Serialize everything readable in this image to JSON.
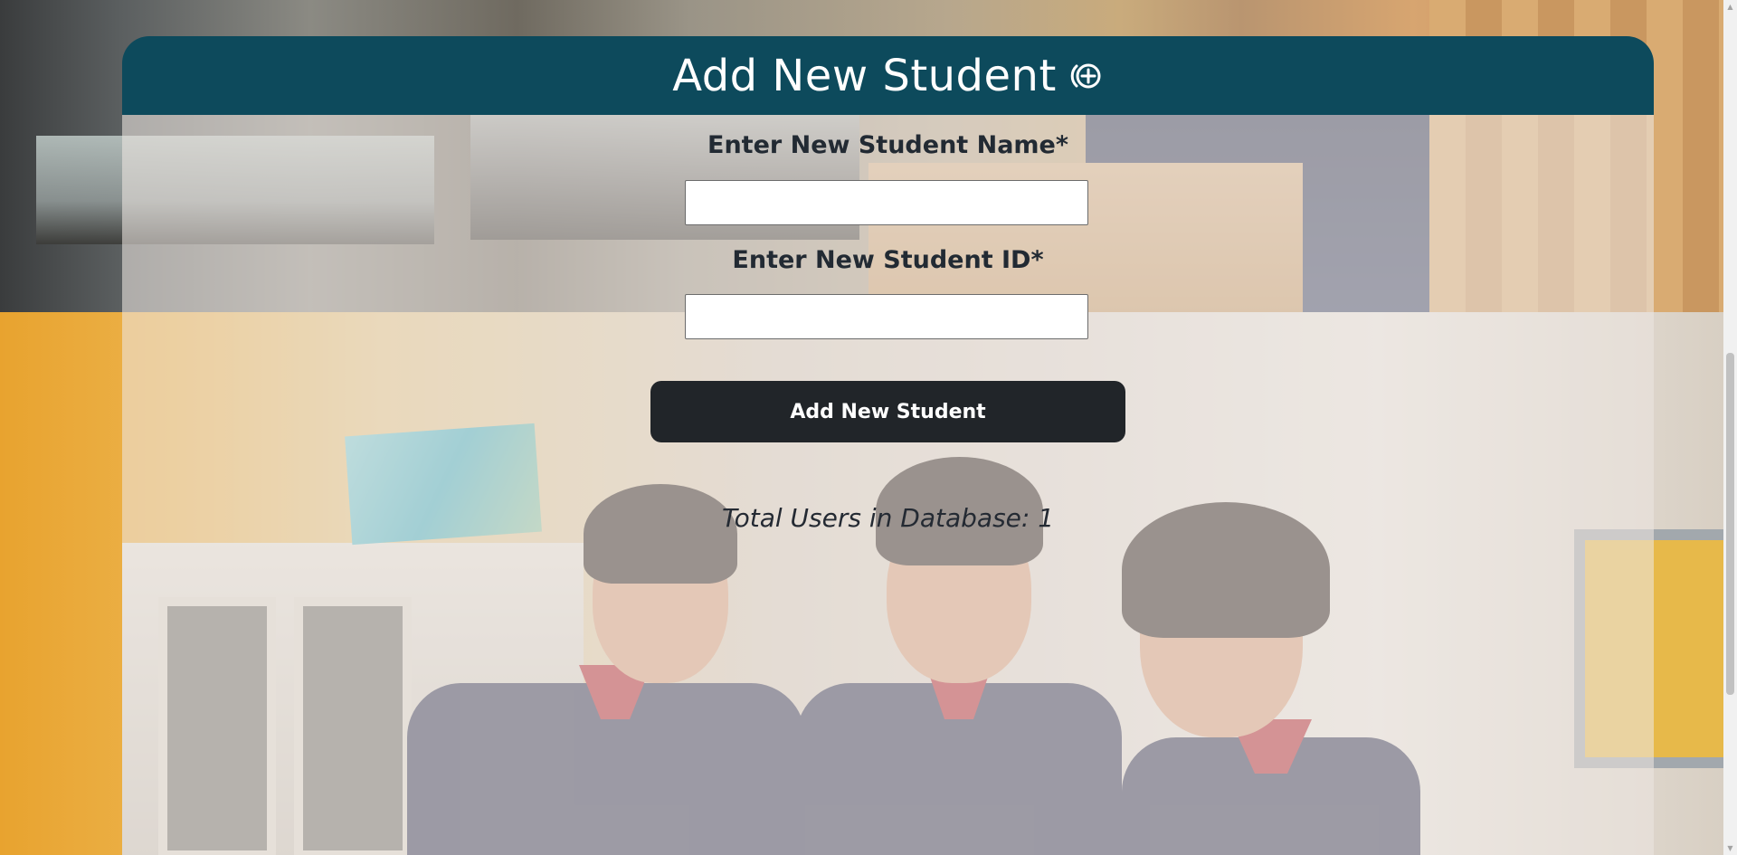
{
  "header": {
    "title": "Add New Student",
    "icon": "add-circle-icon"
  },
  "form": {
    "name_label": "Enter New Student Name*",
    "name_value": "",
    "id_label": "Enter New Student ID*",
    "id_value": "",
    "submit_label": "Add New Student"
  },
  "stats": {
    "total_users_text": "Total Users in Database: 1"
  },
  "colors": {
    "header_bg": "#0d4a5c",
    "button_bg": "#212529",
    "text_dark": "#222a33"
  }
}
